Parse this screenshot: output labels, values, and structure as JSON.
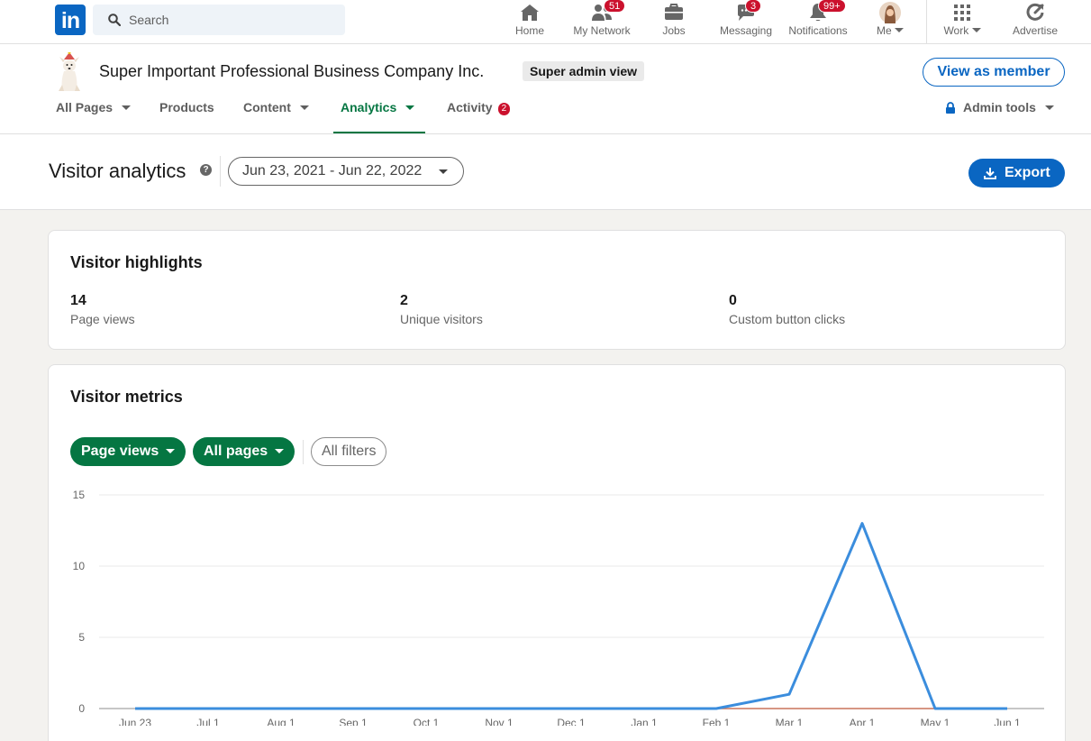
{
  "nav": {
    "logo": "in",
    "search_placeholder": "Search",
    "items": [
      {
        "label": "Home",
        "badge": ""
      },
      {
        "label": "My Network",
        "badge": "51"
      },
      {
        "label": "Jobs",
        "badge": ""
      },
      {
        "label": "Messaging",
        "badge": "3"
      },
      {
        "label": "Notifications",
        "badge": "99+"
      },
      {
        "label": "Me",
        "badge": ""
      },
      {
        "label": "Work",
        "badge": ""
      },
      {
        "label": "Advertise",
        "badge": ""
      }
    ]
  },
  "org": {
    "name": "Super Important Professional Business Company Inc.",
    "admin_badge": "Super admin view",
    "view_as_member": "View as member",
    "tabs": [
      {
        "label": "All Pages"
      },
      {
        "label": "Products"
      },
      {
        "label": "Content"
      },
      {
        "label": "Analytics"
      },
      {
        "label": "Activity",
        "count": "2"
      },
      {
        "label": "Admin tools"
      }
    ]
  },
  "page": {
    "title": "Visitor analytics",
    "help": "?",
    "date_range": "Jun 23, 2021 - Jun 22, 2022",
    "export": "Export"
  },
  "highlights": {
    "title": "Visitor highlights",
    "items": [
      {
        "value": "14",
        "label": "Page views"
      },
      {
        "value": "2",
        "label": "Unique visitors"
      },
      {
        "value": "0",
        "label": "Custom button clicks"
      }
    ]
  },
  "metrics": {
    "title": "Visitor metrics",
    "filters": {
      "metric": "Page views",
      "pages": "All pages",
      "all": "All filters"
    }
  },
  "colors": {
    "brand": "#0a66c2",
    "green": "#057642",
    "badge": "#cb112d",
    "series_line": "#3b8ddd",
    "series_baseline": "#c8735a"
  },
  "chart_data": {
    "type": "line",
    "categories": [
      "Jun 23",
      "Jul 1",
      "Aug 1",
      "Sep 1",
      "Oct 1",
      "Nov 1",
      "Dec 1",
      "Jan 1",
      "Feb 1",
      "Mar 1",
      "Apr 1",
      "May 1",
      "Jun 1"
    ],
    "ylim": [
      0,
      15
    ],
    "yticks": [
      "0",
      "5",
      "10",
      "15"
    ],
    "grid": true,
    "series": [
      {
        "values": [
          0,
          0,
          0,
          0,
          0,
          0,
          0,
          0,
          0,
          1,
          13,
          0,
          0
        ]
      },
      {
        "values": [
          0,
          0,
          0,
          0,
          0,
          0,
          0,
          0,
          0,
          0,
          0,
          0,
          0
        ]
      }
    ]
  }
}
